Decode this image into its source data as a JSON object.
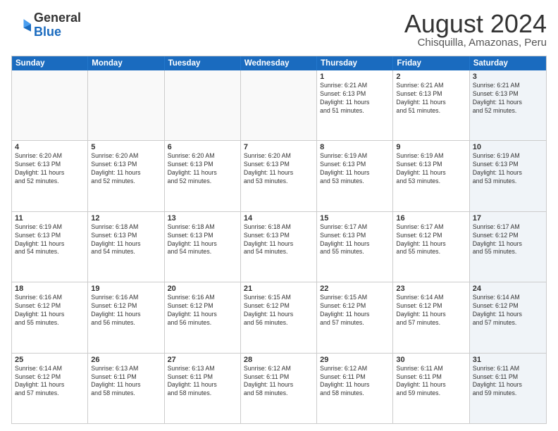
{
  "header": {
    "logo_line1": "General",
    "logo_line2": "Blue",
    "main_title": "August 2024",
    "subtitle": "Chisquilla, Amazonas, Peru"
  },
  "days_of_week": [
    "Sunday",
    "Monday",
    "Tuesday",
    "Wednesday",
    "Thursday",
    "Friday",
    "Saturday"
  ],
  "weeks": [
    [
      {
        "day": "",
        "text": "",
        "empty": true
      },
      {
        "day": "",
        "text": "",
        "empty": true
      },
      {
        "day": "",
        "text": "",
        "empty": true
      },
      {
        "day": "",
        "text": "",
        "empty": true
      },
      {
        "day": "1",
        "text": "Sunrise: 6:21 AM\nSunset: 6:13 PM\nDaylight: 11 hours\nand 51 minutes.",
        "shaded": false
      },
      {
        "day": "2",
        "text": "Sunrise: 6:21 AM\nSunset: 6:13 PM\nDaylight: 11 hours\nand 51 minutes.",
        "shaded": false
      },
      {
        "day": "3",
        "text": "Sunrise: 6:21 AM\nSunset: 6:13 PM\nDaylight: 11 hours\nand 52 minutes.",
        "shaded": true
      }
    ],
    [
      {
        "day": "4",
        "text": "Sunrise: 6:20 AM\nSunset: 6:13 PM\nDaylight: 11 hours\nand 52 minutes.",
        "shaded": false
      },
      {
        "day": "5",
        "text": "Sunrise: 6:20 AM\nSunset: 6:13 PM\nDaylight: 11 hours\nand 52 minutes.",
        "shaded": false
      },
      {
        "day": "6",
        "text": "Sunrise: 6:20 AM\nSunset: 6:13 PM\nDaylight: 11 hours\nand 52 minutes.",
        "shaded": false
      },
      {
        "day": "7",
        "text": "Sunrise: 6:20 AM\nSunset: 6:13 PM\nDaylight: 11 hours\nand 53 minutes.",
        "shaded": false
      },
      {
        "day": "8",
        "text": "Sunrise: 6:19 AM\nSunset: 6:13 PM\nDaylight: 11 hours\nand 53 minutes.",
        "shaded": false
      },
      {
        "day": "9",
        "text": "Sunrise: 6:19 AM\nSunset: 6:13 PM\nDaylight: 11 hours\nand 53 minutes.",
        "shaded": false
      },
      {
        "day": "10",
        "text": "Sunrise: 6:19 AM\nSunset: 6:13 PM\nDaylight: 11 hours\nand 53 minutes.",
        "shaded": true
      }
    ],
    [
      {
        "day": "11",
        "text": "Sunrise: 6:19 AM\nSunset: 6:13 PM\nDaylight: 11 hours\nand 54 minutes.",
        "shaded": false
      },
      {
        "day": "12",
        "text": "Sunrise: 6:18 AM\nSunset: 6:13 PM\nDaylight: 11 hours\nand 54 minutes.",
        "shaded": false
      },
      {
        "day": "13",
        "text": "Sunrise: 6:18 AM\nSunset: 6:13 PM\nDaylight: 11 hours\nand 54 minutes.",
        "shaded": false
      },
      {
        "day": "14",
        "text": "Sunrise: 6:18 AM\nSunset: 6:13 PM\nDaylight: 11 hours\nand 54 minutes.",
        "shaded": false
      },
      {
        "day": "15",
        "text": "Sunrise: 6:17 AM\nSunset: 6:13 PM\nDaylight: 11 hours\nand 55 minutes.",
        "shaded": false
      },
      {
        "day": "16",
        "text": "Sunrise: 6:17 AM\nSunset: 6:12 PM\nDaylight: 11 hours\nand 55 minutes.",
        "shaded": false
      },
      {
        "day": "17",
        "text": "Sunrise: 6:17 AM\nSunset: 6:12 PM\nDaylight: 11 hours\nand 55 minutes.",
        "shaded": true
      }
    ],
    [
      {
        "day": "18",
        "text": "Sunrise: 6:16 AM\nSunset: 6:12 PM\nDaylight: 11 hours\nand 55 minutes.",
        "shaded": false
      },
      {
        "day": "19",
        "text": "Sunrise: 6:16 AM\nSunset: 6:12 PM\nDaylight: 11 hours\nand 56 minutes.",
        "shaded": false
      },
      {
        "day": "20",
        "text": "Sunrise: 6:16 AM\nSunset: 6:12 PM\nDaylight: 11 hours\nand 56 minutes.",
        "shaded": false
      },
      {
        "day": "21",
        "text": "Sunrise: 6:15 AM\nSunset: 6:12 PM\nDaylight: 11 hours\nand 56 minutes.",
        "shaded": false
      },
      {
        "day": "22",
        "text": "Sunrise: 6:15 AM\nSunset: 6:12 PM\nDaylight: 11 hours\nand 57 minutes.",
        "shaded": false
      },
      {
        "day": "23",
        "text": "Sunrise: 6:14 AM\nSunset: 6:12 PM\nDaylight: 11 hours\nand 57 minutes.",
        "shaded": false
      },
      {
        "day": "24",
        "text": "Sunrise: 6:14 AM\nSunset: 6:12 PM\nDaylight: 11 hours\nand 57 minutes.",
        "shaded": true
      }
    ],
    [
      {
        "day": "25",
        "text": "Sunrise: 6:14 AM\nSunset: 6:12 PM\nDaylight: 11 hours\nand 57 minutes.",
        "shaded": false
      },
      {
        "day": "26",
        "text": "Sunrise: 6:13 AM\nSunset: 6:11 PM\nDaylight: 11 hours\nand 58 minutes.",
        "shaded": false
      },
      {
        "day": "27",
        "text": "Sunrise: 6:13 AM\nSunset: 6:11 PM\nDaylight: 11 hours\nand 58 minutes.",
        "shaded": false
      },
      {
        "day": "28",
        "text": "Sunrise: 6:12 AM\nSunset: 6:11 PM\nDaylight: 11 hours\nand 58 minutes.",
        "shaded": false
      },
      {
        "day": "29",
        "text": "Sunrise: 6:12 AM\nSunset: 6:11 PM\nDaylight: 11 hours\nand 58 minutes.",
        "shaded": false
      },
      {
        "day": "30",
        "text": "Sunrise: 6:11 AM\nSunset: 6:11 PM\nDaylight: 11 hours\nand 59 minutes.",
        "shaded": false
      },
      {
        "day": "31",
        "text": "Sunrise: 6:11 AM\nSunset: 6:11 PM\nDaylight: 11 hours\nand 59 minutes.",
        "shaded": true
      }
    ]
  ]
}
